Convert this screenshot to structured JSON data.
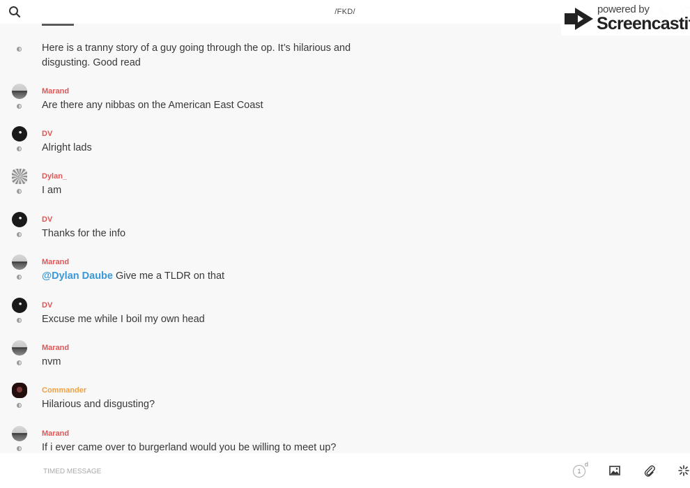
{
  "topbar": {
    "title": "/FKD/",
    "search_icon": "search-icon",
    "phone_icon": "phone-icon",
    "info_icon": "info-icon"
  },
  "watermark": {
    "line1": "powered by",
    "line2": "Screencastify"
  },
  "colors": {
    "author_red": "#e05656",
    "author_orange": "#f0a040",
    "mention_blue": "#3a98d8"
  },
  "messages": [
    {
      "author": "",
      "text": "Here is a tranny story of a guy going through the op. It’s hilarious and disgusting. Good read"
    },
    {
      "author": "Marand",
      "text": "Are there any nibbas on the American East Coast"
    },
    {
      "author": "DV",
      "text": "Alright lads"
    },
    {
      "author": "Dylan_",
      "text": "I am"
    },
    {
      "author": "DV",
      "text": "Thanks for the info"
    },
    {
      "author": "Marand",
      "mention": "@Dylan Daube",
      "text": " Give me a TLDR on that"
    },
    {
      "author": "DV",
      "text": "Excuse me while I boil my own head"
    },
    {
      "author": "Marand",
      "text": "nvm"
    },
    {
      "author": "Commander",
      "text": "Hilarious and disgusting?"
    },
    {
      "author": "Marand",
      "text": "If i ever came over to burgerland would you be willing to meet  up?"
    }
  ],
  "composer": {
    "placeholder": "TIMED MESSAGE",
    "timer_value": "1",
    "timer_unit": "d",
    "image_icon": "image-icon",
    "attach_icon": "paperclip-icon",
    "sparkle_icon": "sparkle-icon"
  }
}
